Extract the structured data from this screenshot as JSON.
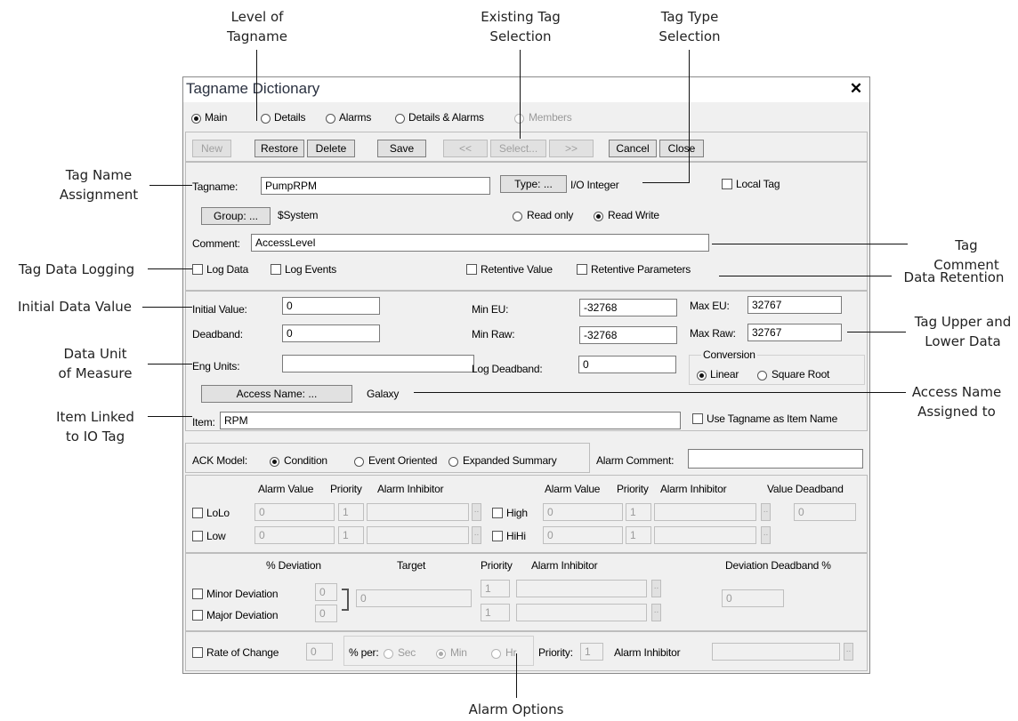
{
  "annotations": {
    "level": [
      "Level of",
      "Tagname"
    ],
    "existing": [
      "Existing Tag",
      "Selection"
    ],
    "tagtype": [
      "Tag Type",
      "Selection"
    ],
    "tagname_assign": [
      "Tag Name",
      "Assignment"
    ],
    "tag_comment": "Tag Comment",
    "data_logging": "Tag Data Logging",
    "data_retention": "Data Retention",
    "initial_value": "Initial Data Value",
    "upper_lower": [
      "Tag Upper and",
      "Lower Data"
    ],
    "unit_measure": [
      "Data Unit",
      "of Measure"
    ],
    "access_name": [
      "Access Name",
      "Assigned to"
    ],
    "item_linked": [
      "Item Linked",
      "to IO Tag"
    ],
    "alarm_options": "Alarm Options"
  },
  "window": {
    "title": "Tagname Dictionary",
    "close_glyph": "✕",
    "modes": [
      {
        "label": "Main",
        "checked": true,
        "enabled": true
      },
      {
        "label": "Details",
        "checked": false,
        "enabled": true
      },
      {
        "label": "Alarms",
        "checked": false,
        "enabled": true
      },
      {
        "label": "Details & Alarms",
        "checked": false,
        "enabled": true
      },
      {
        "label": "Members",
        "checked": false,
        "enabled": false
      }
    ],
    "toolbar": {
      "new": "New",
      "restore": "Restore",
      "delete": "Delete",
      "save": "Save",
      "prev": "<<",
      "select": "Select...",
      "next": ">>",
      "cancel": "Cancel",
      "close": "Close"
    }
  },
  "main": {
    "tagname_label": "Tagname:",
    "tagname_value": "PumpRPM",
    "type_button": "Type: ...",
    "type_value": "I/O Integer",
    "local_tag": "Local Tag",
    "group_button": "Group: ...",
    "group_value": "$System",
    "read_only": "Read only",
    "read_write": "Read Write",
    "comment_label": "Comment:",
    "comment_value": "AccessLevel",
    "log_data": "Log Data",
    "log_events": "Log Events",
    "retentive_value": "Retentive Value",
    "retentive_params": "Retentive Parameters"
  },
  "details": {
    "initial_label": "Initial Value:",
    "initial_value": "0",
    "deadband_label": "Deadband:",
    "deadband_value": "0",
    "eng_units_label": "Eng Units:",
    "eng_units_value": "",
    "min_eu_label": "Min EU:",
    "min_eu_value": "-32768",
    "min_raw_label": "Min Raw:",
    "min_raw_value": "-32768",
    "log_deadband_label": "Log Deadband:",
    "log_deadband_value": "0",
    "max_eu_label": "Max EU:",
    "max_eu_value": "32767",
    "max_raw_label": "Max Raw:",
    "max_raw_value": "32767",
    "conversion_label": "Conversion",
    "linear": "Linear",
    "square_root": "Square Root",
    "access_button": "Access Name: ...",
    "access_value": "Galaxy",
    "item_label": "Item:",
    "item_value": "RPM",
    "use_tagname": "Use Tagname as Item Name"
  },
  "alarms": {
    "ack_label": "ACK Model:",
    "condition": "Condition",
    "event_oriented": "Event Oriented",
    "expanded": "Expanded Summary",
    "alarm_comment_label": "Alarm Comment:",
    "alarm_comment_value": "",
    "hdr_alarm_value": "Alarm Value",
    "hdr_priority": "Priority",
    "hdr_inhibitor": "Alarm Inhibitor",
    "hdr_value_deadband": "Value Deadband",
    "lolo": "LoLo",
    "low": "Low",
    "high": "High",
    "hihi": "HiHi",
    "lolo_value": "0",
    "lolo_priority": "1",
    "low_value": "0",
    "low_priority": "1",
    "high_value": "0",
    "high_priority": "1",
    "hihi_value": "0",
    "hihi_priority": "1",
    "value_deadband": "0",
    "ellipsis": "..",
    "hdr_deviation": "% Deviation",
    "hdr_target": "Target",
    "hdr_priority2": "Priority",
    "hdr_inhibitor2": "Alarm Inhibitor",
    "hdr_dev_deadband": "Deviation Deadband %",
    "minor_dev": "Minor Deviation",
    "major_dev": "Major Deviation",
    "minor_value": "0",
    "major_value": "0",
    "target_value": "0",
    "minor_priority": "1",
    "major_priority": "1",
    "dev_deadband_value": "0",
    "rate_of_change": "Rate of Change",
    "rate_value": "0",
    "per_label": "% per:",
    "sec": "Sec",
    "min": "Min",
    "hr": "Hr",
    "priority_label": "Priority:",
    "rate_priority": "1",
    "inhibitor_label": "Alarm Inhibitor"
  }
}
